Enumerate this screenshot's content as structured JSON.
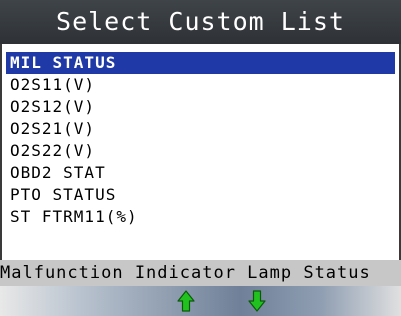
{
  "header": {
    "title": "Select Custom List"
  },
  "list": {
    "items": [
      {
        "label": "MIL STATUS",
        "selected": true
      },
      {
        "label": "O2S11(V)",
        "selected": false
      },
      {
        "label": "O2S12(V)",
        "selected": false
      },
      {
        "label": "O2S21(V)",
        "selected": false
      },
      {
        "label": "O2S22(V)",
        "selected": false
      },
      {
        "label": "OBD2 STAT",
        "selected": false
      },
      {
        "label": "PTO STATUS",
        "selected": false
      },
      {
        "label": "ST FTRM11(%)",
        "selected": false
      }
    ]
  },
  "description": {
    "text": "Malfunction Indicator Lamp Status"
  },
  "softkeys": {
    "up_icon": "up-arrow-icon",
    "down_icon": "down-arrow-icon"
  },
  "colors": {
    "selection": "#1f3aa6",
    "title_bar": "#2e3236",
    "arrow_green": "#21c21f",
    "description_bar": "#c7c7c7"
  }
}
